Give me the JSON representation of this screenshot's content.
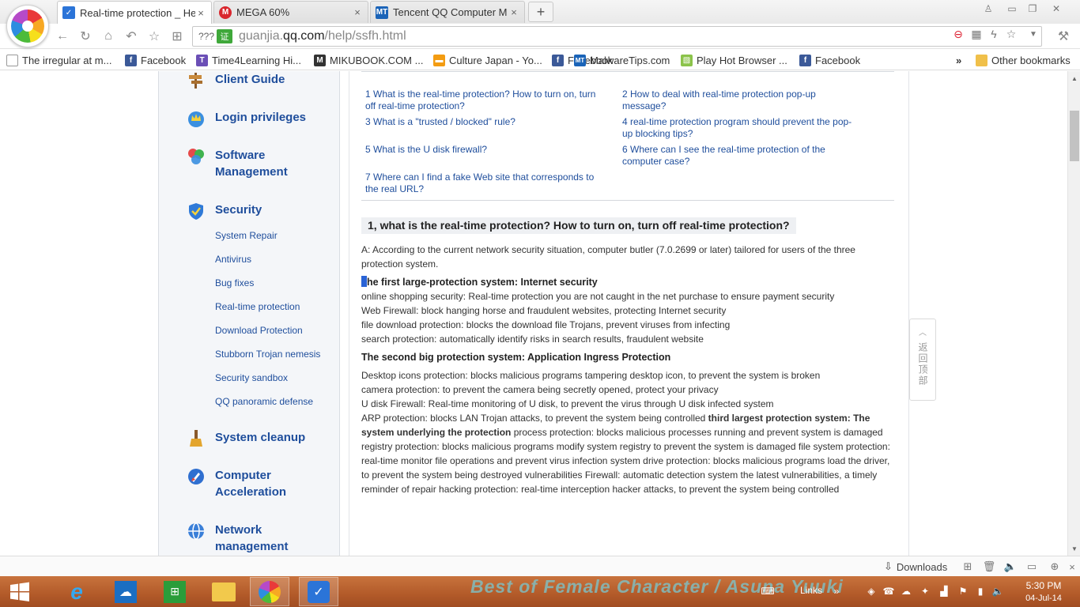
{
  "browser": {
    "tabs": [
      {
        "label": "Real-time protection _ He",
        "icon": "shield-icon",
        "active": true
      },
      {
        "label": "MEGA 60%",
        "icon": "mega-icon",
        "active": false
      },
      {
        "label": "Tencent QQ Computer M",
        "icon": "mt-icon",
        "active": false
      }
    ],
    "new_tab_label": "+",
    "address": {
      "prefix": "???",
      "cert": "证",
      "url_domain_pre": "guanjia.",
      "url_domain": "qq.com",
      "url_path": "/help/ssfh.html"
    },
    "bookmarks": [
      {
        "label": "The irregular at m...",
        "icon": "page-icon"
      },
      {
        "label": "Facebook",
        "icon": "facebook-icon"
      },
      {
        "label": "Time4Learning Hi...",
        "icon": "time4learning-icon"
      },
      {
        "label": "MIKUBOOK.COM ...",
        "icon": "mikubook-icon"
      },
      {
        "label": "Culture Japan - Yo...",
        "icon": "culture-japan-icon"
      },
      {
        "label": "Facebook",
        "icon": "facebook-icon"
      },
      {
        "label": "MalwareTips.com",
        "icon": "mt-icon"
      },
      {
        "label": "Play Hot Browser ...",
        "icon": "game-icon"
      },
      {
        "label": "Facebook",
        "icon": "facebook-icon"
      }
    ],
    "bookmarks_overflow": "»",
    "other_bookmarks": "Other bookmarks",
    "downloads_label": "Downloads"
  },
  "sidebar": {
    "groups": [
      {
        "label": "Client Guide",
        "icon": "signpost-icon"
      },
      {
        "label": "Login privileges",
        "icon": "crown-icon"
      },
      {
        "label": "Software Management",
        "icon": "software-icon"
      },
      {
        "label": "Security",
        "icon": "shield-icon"
      },
      {
        "label": "System cleanup",
        "icon": "broom-icon"
      },
      {
        "label": "Computer Acceleration",
        "icon": "rocket-icon"
      },
      {
        "label": "Network management",
        "icon": "globe-icon"
      }
    ],
    "security_items": [
      "System Repair",
      "Antivirus",
      "Bug fixes",
      "Real-time protection",
      "Download Protection",
      "Stubborn Trojan nemesis",
      "Security sandbox",
      "QQ panoramic defense"
    ]
  },
  "main": {
    "toc": [
      "1 What is the real-time protection? How to turn on, turn off real-time protection?",
      "2 How to deal with real-time protection pop-up message?",
      "3 What is a \"trusted / blocked\" rule?",
      "4 real-time protection program should prevent the pop-up blocking tips?",
      "5 What is the U disk firewall?",
      "6 Where can I see the real-time protection of the computer case?",
      "7 Where can I find a fake Web site that corresponds to the real URL?"
    ],
    "section_title": "1, what is the real-time protection? How to turn on, turn off real-time protection?",
    "answer_intro": "A: According to the current network security situation, computer butler (7.0.2699 or later) tailored for users of the three protection system.",
    "first_system_heading": "he first large-protection system: Internet security",
    "first_system_items": [
      "online shopping security: Real-time protection you are not caught in the net purchase to ensure payment security",
      "Web Firewall: block hanging horse and fraudulent websites, protecting Internet security",
      "file download protection: blocks the download file Trojans, prevent viruses from infecting",
      "search protection: automatically identify risks in search results, fraudulent website"
    ],
    "second_system_heading": "The second big protection system: Application Ingress Protection",
    "second_system_items": [
      "Desktop icons protection: blocks malicious programs tampering desktop icon, to prevent the system is broken",
      "camera protection: to prevent the camera being secretly opened, protect your privacy",
      "U disk Firewall: Real-time monitoring of U disk, to prevent the virus through U disk infected system"
    ],
    "arp_text": "ARP protection: blocks LAN Trojan attacks, to prevent the system being controlled ",
    "third_heading_a": "third largest protection system:",
    "third_heading_b": "The system underlying the protection",
    "third_text": " process protection: blocks malicious processes running and prevent system is damaged registry protection: blocks malicious programs modify system registry to prevent the system is damaged file system protection: real-time monitor file operations and prevent virus infection system drive protection: blocks malicious programs load the driver, to prevent the system being destroyed vulnerabilities Firewall: automatic detection system the latest vulnerabilities, a timely reminder of repair hacking protection: real-time interception hacker attacks, to prevent the system being controlled",
    "back_to_top": "返回顶部"
  },
  "taskbar": {
    "wallpaper_text": "Best of Female Character / Asuna Yuuki",
    "links_label": "Links",
    "time": "5:30 PM",
    "date": "04-Jul-14"
  },
  "colors": {
    "link_blue": "#1f4e9c",
    "sidebar_bg": "#f4f6f9",
    "taskbar": "#b25a29"
  }
}
